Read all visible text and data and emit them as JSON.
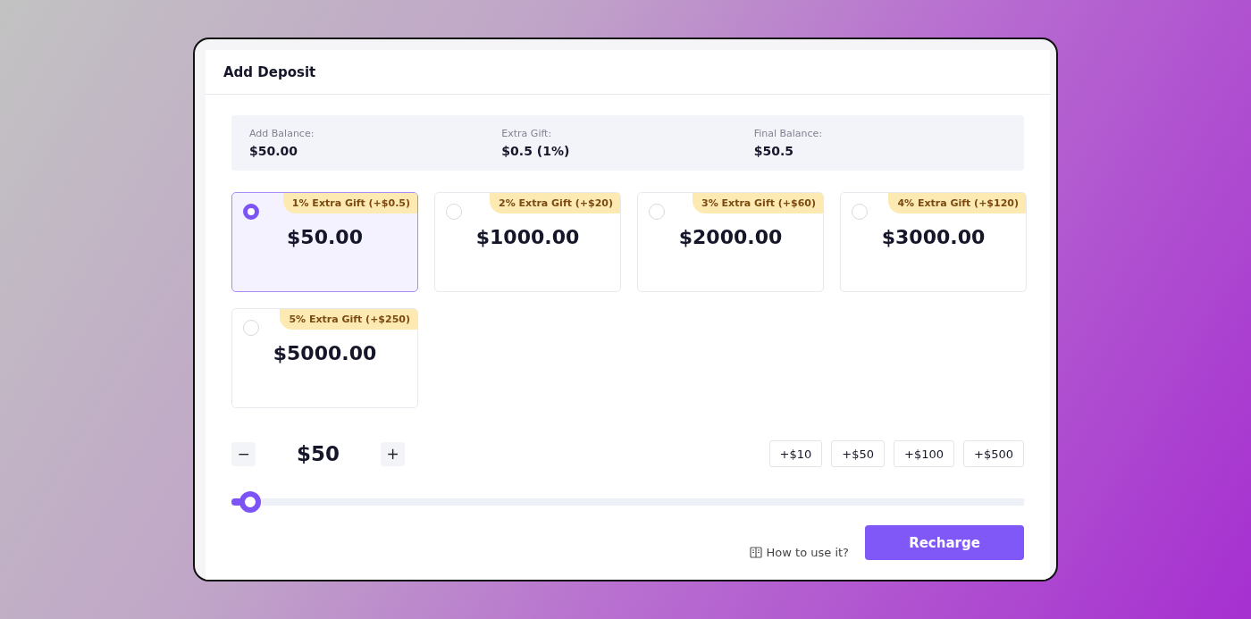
{
  "window": {
    "title": "Add Deposit"
  },
  "summary": [
    {
      "label": "Add Balance:",
      "value": "$50.00"
    },
    {
      "label": "Extra Gift:",
      "value": "$0.5 (1%)"
    },
    {
      "label": "Final Balance:",
      "value": "$50.5"
    }
  ],
  "packages": [
    {
      "badge": "1% Extra Gift (+$0.5)",
      "amount": "$50.00",
      "selected": true
    },
    {
      "badge": "2% Extra Gift (+$20)",
      "amount": "$1000.00",
      "selected": false
    },
    {
      "badge": "3% Extra Gift (+$60)",
      "amount": "$2000.00",
      "selected": false
    },
    {
      "badge": "4% Extra Gift (+$120)",
      "amount": "$3000.00",
      "selected": false
    },
    {
      "badge": "5% Extra Gift (+$250)",
      "amount": "$5000.00",
      "selected": false
    }
  ],
  "stepper": {
    "minus": "−",
    "value": "$50",
    "plus": "+"
  },
  "quick_add": [
    "+$10",
    "+$50",
    "+$100",
    "+$500"
  ],
  "slider": {
    "level": 0.015
  },
  "help_link": "How to use it?",
  "submit": "Recharge"
}
